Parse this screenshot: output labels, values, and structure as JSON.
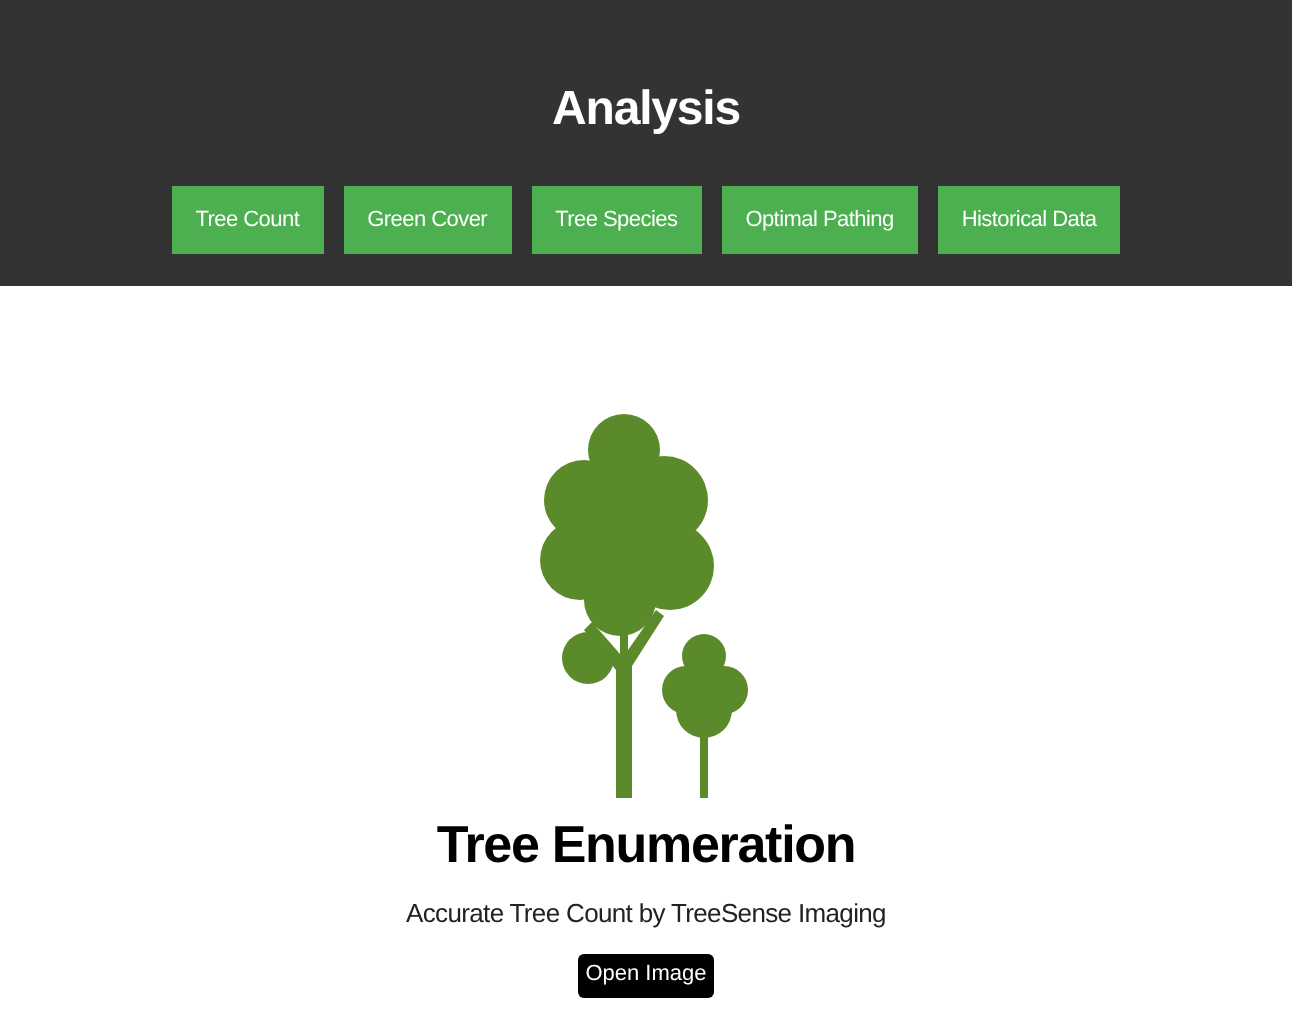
{
  "header": {
    "title": "Analysis",
    "nav": [
      {
        "label": "Tree Count"
      },
      {
        "label": "Green Cover"
      },
      {
        "label": "Tree Species"
      },
      {
        "label": "Optimal Pathing"
      },
      {
        "label": "Historical Data"
      }
    ]
  },
  "hero": {
    "title": "Tree Enumeration",
    "subtitle": "Accurate Tree Count by TreeSense Imaging",
    "button": "Open Image"
  }
}
